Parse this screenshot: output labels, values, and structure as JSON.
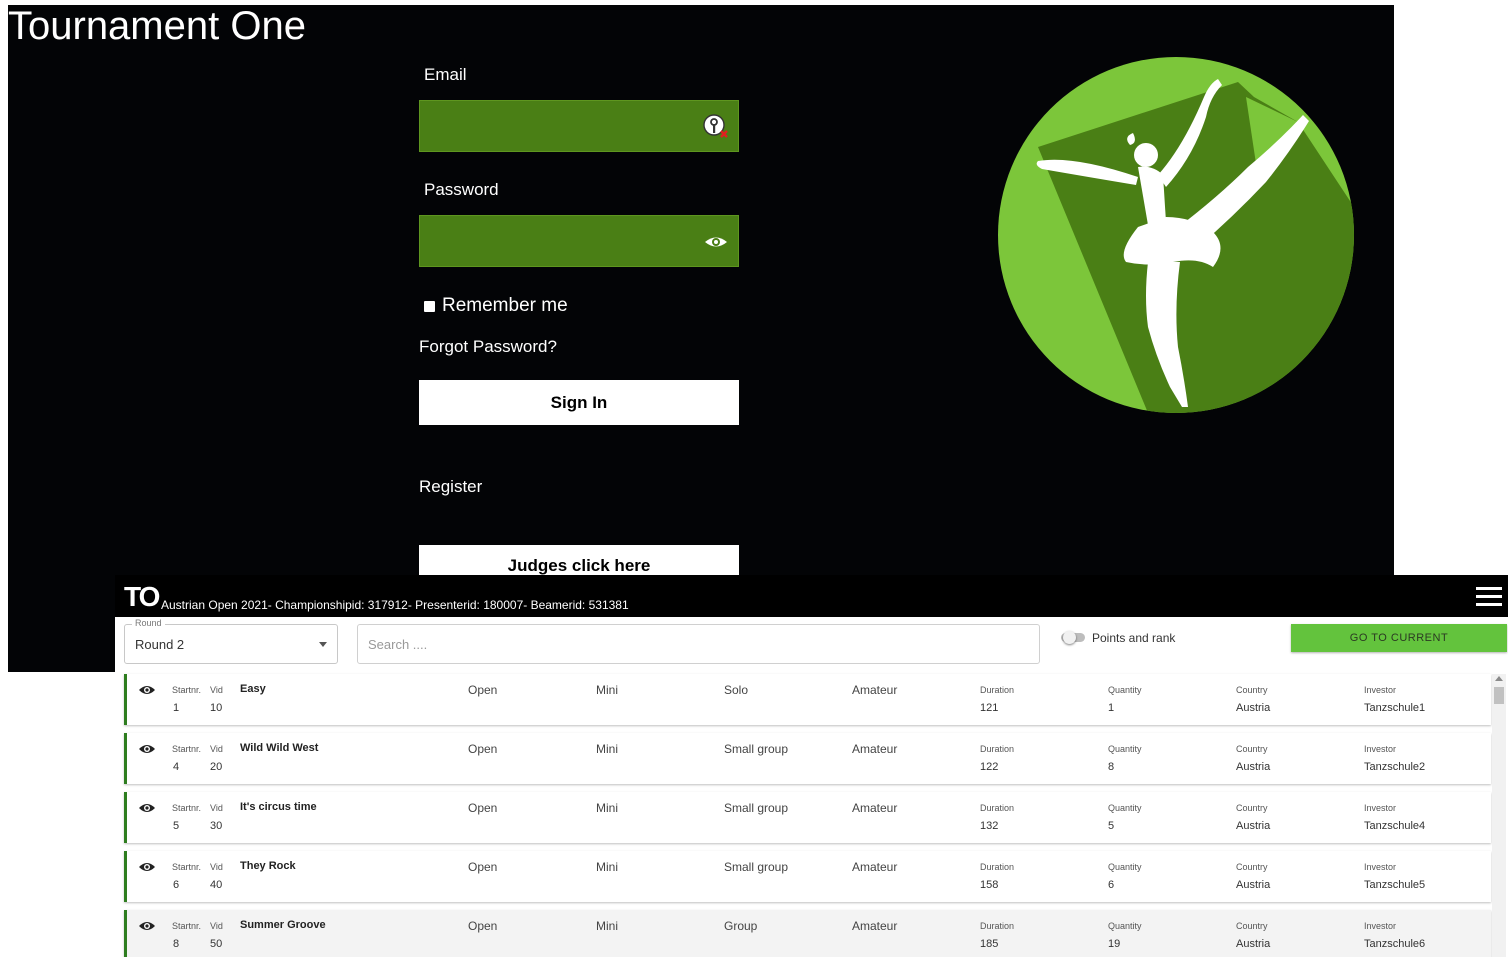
{
  "login": {
    "app_title": "Tournament One",
    "email_label": "Email",
    "email_value": "",
    "password_label": "Password",
    "password_value": "",
    "remember_label": "Remember me",
    "forgot_label": "Forgot Password?",
    "sign_in_label": "Sign In",
    "register_label": "Register",
    "judges_label": "Judges click here",
    "colors": {
      "input_bg": "#4a7f15",
      "logo_light": "#7cc63a",
      "logo_dark": "#4a7f15",
      "background": "#030406"
    }
  },
  "list": {
    "logo": "TO",
    "meta": "Austrian Open 2021- Championshipid: 317912- Presenterid: 180007- Beamerid: 531381",
    "round_legend": "Round",
    "round_value": "Round 2",
    "search_placeholder": "Search ....",
    "points_label": "Points and rank",
    "points_on": false,
    "go_label": "GO TO CURRENT",
    "col_labels": {
      "startnr": "Startnr.",
      "vid": "Vid",
      "duration": "Duration",
      "quantity": "Quantity",
      "country": "Country",
      "investor": "Investor"
    },
    "rows": [
      {
        "startnr": "1",
        "vid": "10",
        "title": "Easy",
        "level": "Open",
        "age": "Mini",
        "category": "Solo",
        "type": "Amateur",
        "duration": "121",
        "quantity": "1",
        "country": "Austria",
        "investor": "Tanzschule1"
      },
      {
        "startnr": "4",
        "vid": "20",
        "title": "Wild Wild West",
        "level": "Open",
        "age": "Mini",
        "category": "Small group",
        "type": "Amateur",
        "duration": "122",
        "quantity": "8",
        "country": "Austria",
        "investor": "Tanzschule2"
      },
      {
        "startnr": "5",
        "vid": "30",
        "title": "It's circus time",
        "level": "Open",
        "age": "Mini",
        "category": "Small group",
        "type": "Amateur",
        "duration": "132",
        "quantity": "5",
        "country": "Austria",
        "investor": "Tanzschule4"
      },
      {
        "startnr": "6",
        "vid": "40",
        "title": "They Rock",
        "level": "Open",
        "age": "Mini",
        "category": "Small group",
        "type": "Amateur",
        "duration": "158",
        "quantity": "6",
        "country": "Austria",
        "investor": "Tanzschule5"
      },
      {
        "startnr": "8",
        "vid": "50",
        "title": "Summer Groove",
        "level": "Open",
        "age": "Mini",
        "category": "Group",
        "type": "Amateur",
        "duration": "185",
        "quantity": "19",
        "country": "Austria",
        "investor": "Tanzschule6"
      }
    ],
    "colors": {
      "row_accent": "#2e7d1f",
      "go_button": "#63c33d",
      "topbar": "#000000"
    }
  }
}
